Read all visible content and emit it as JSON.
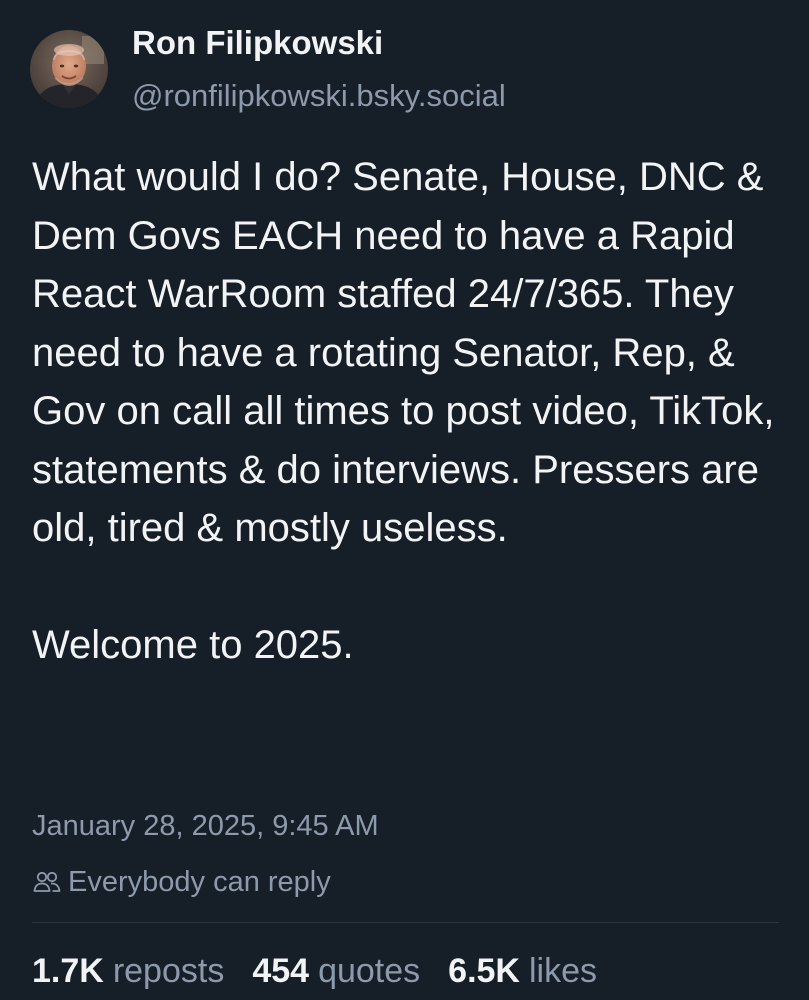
{
  "author": {
    "display_name": "Ron Filipkowski",
    "handle": "@ronfilipkowski.bsky.social"
  },
  "post": {
    "paragraphs": [
      "What would I do? Senate, House, DNC & Dem Govs EACH need to have a Rapid React WarRoom staffed 24/7/365. They need to have a rotating Senator, Rep, & Gov on call all times to post video, TikTok, statements & do interviews. Pressers are old, tired & mostly useless.",
      "Welcome to 2025."
    ],
    "timestamp": "January 28, 2025, 9:45 AM",
    "reply_setting": "Everybody can reply",
    "reply_icon": "people-icon"
  },
  "stats": {
    "reposts": {
      "count": "1.7K",
      "label": "reposts"
    },
    "quotes": {
      "count": "454",
      "label": "quotes"
    },
    "likes": {
      "count": "6.5K",
      "label": "likes"
    }
  },
  "colors": {
    "background": "#161e27",
    "text_primary": "#f1f3f5",
    "text_secondary": "#8c9aab",
    "divider": "#2b3745"
  }
}
